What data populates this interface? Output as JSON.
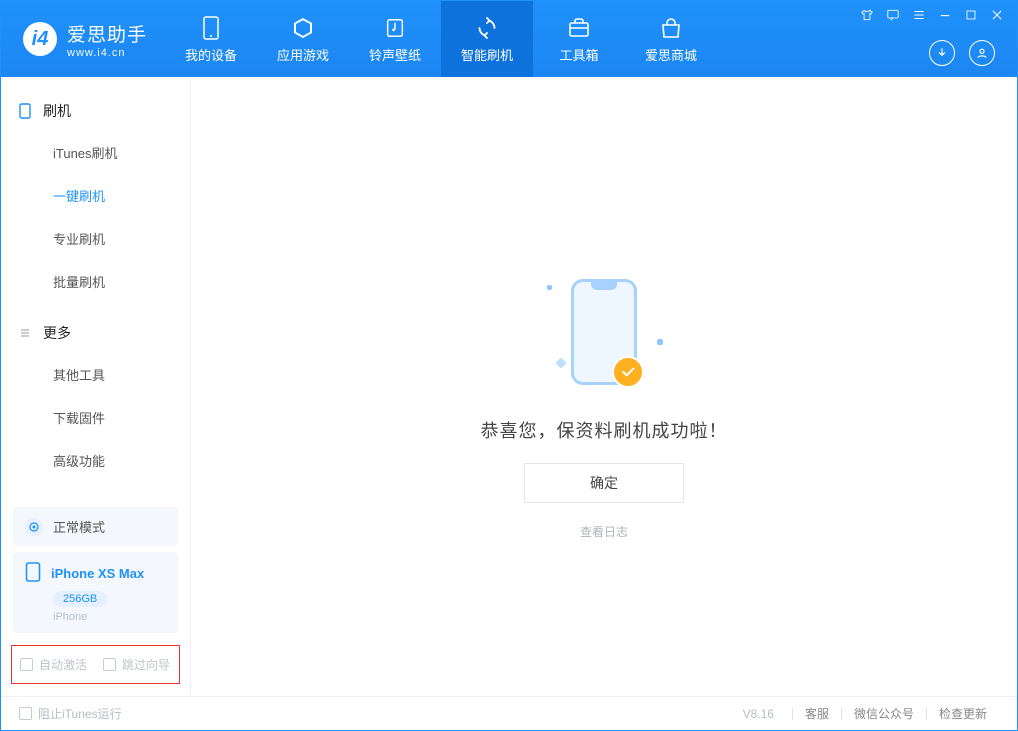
{
  "app": {
    "name_cn": "爱思助手",
    "name_en": "www.i4.cn"
  },
  "nav": [
    {
      "id": "device",
      "label": "我的设备",
      "icon": "phone-icon"
    },
    {
      "id": "apps",
      "label": "应用游戏",
      "icon": "cube-icon"
    },
    {
      "id": "media",
      "label": "铃声壁纸",
      "icon": "music-icon"
    },
    {
      "id": "flash",
      "label": "智能刷机",
      "icon": "refresh-icon",
      "active": true
    },
    {
      "id": "toolbox",
      "label": "工具箱",
      "icon": "briefcase-icon"
    },
    {
      "id": "store",
      "label": "爱思商城",
      "icon": "shop-icon"
    }
  ],
  "sidebar": {
    "group_flash": "刷机",
    "group_more": "更多",
    "items_flash": [
      {
        "label": "iTunes刷机"
      },
      {
        "label": "一键刷机",
        "selected": true
      },
      {
        "label": "专业刷机"
      },
      {
        "label": "批量刷机"
      }
    ],
    "items_more": [
      {
        "label": "其他工具"
      },
      {
        "label": "下载固件"
      },
      {
        "label": "高级功能"
      }
    ]
  },
  "device": {
    "mode_label": "正常模式",
    "name": "iPhone XS Max",
    "storage": "256GB",
    "os": "iPhone"
  },
  "options": {
    "auto_activate": "自动激活",
    "skip_guide": "跳过向导"
  },
  "main": {
    "success_text": "恭喜您，保资料刷机成功啦！",
    "ok_button": "确定",
    "view_log": "查看日志"
  },
  "footer": {
    "block_itunes": "阻止iTunes运行",
    "version": "V8.16",
    "links": [
      "客服",
      "微信公众号",
      "检查更新"
    ]
  }
}
